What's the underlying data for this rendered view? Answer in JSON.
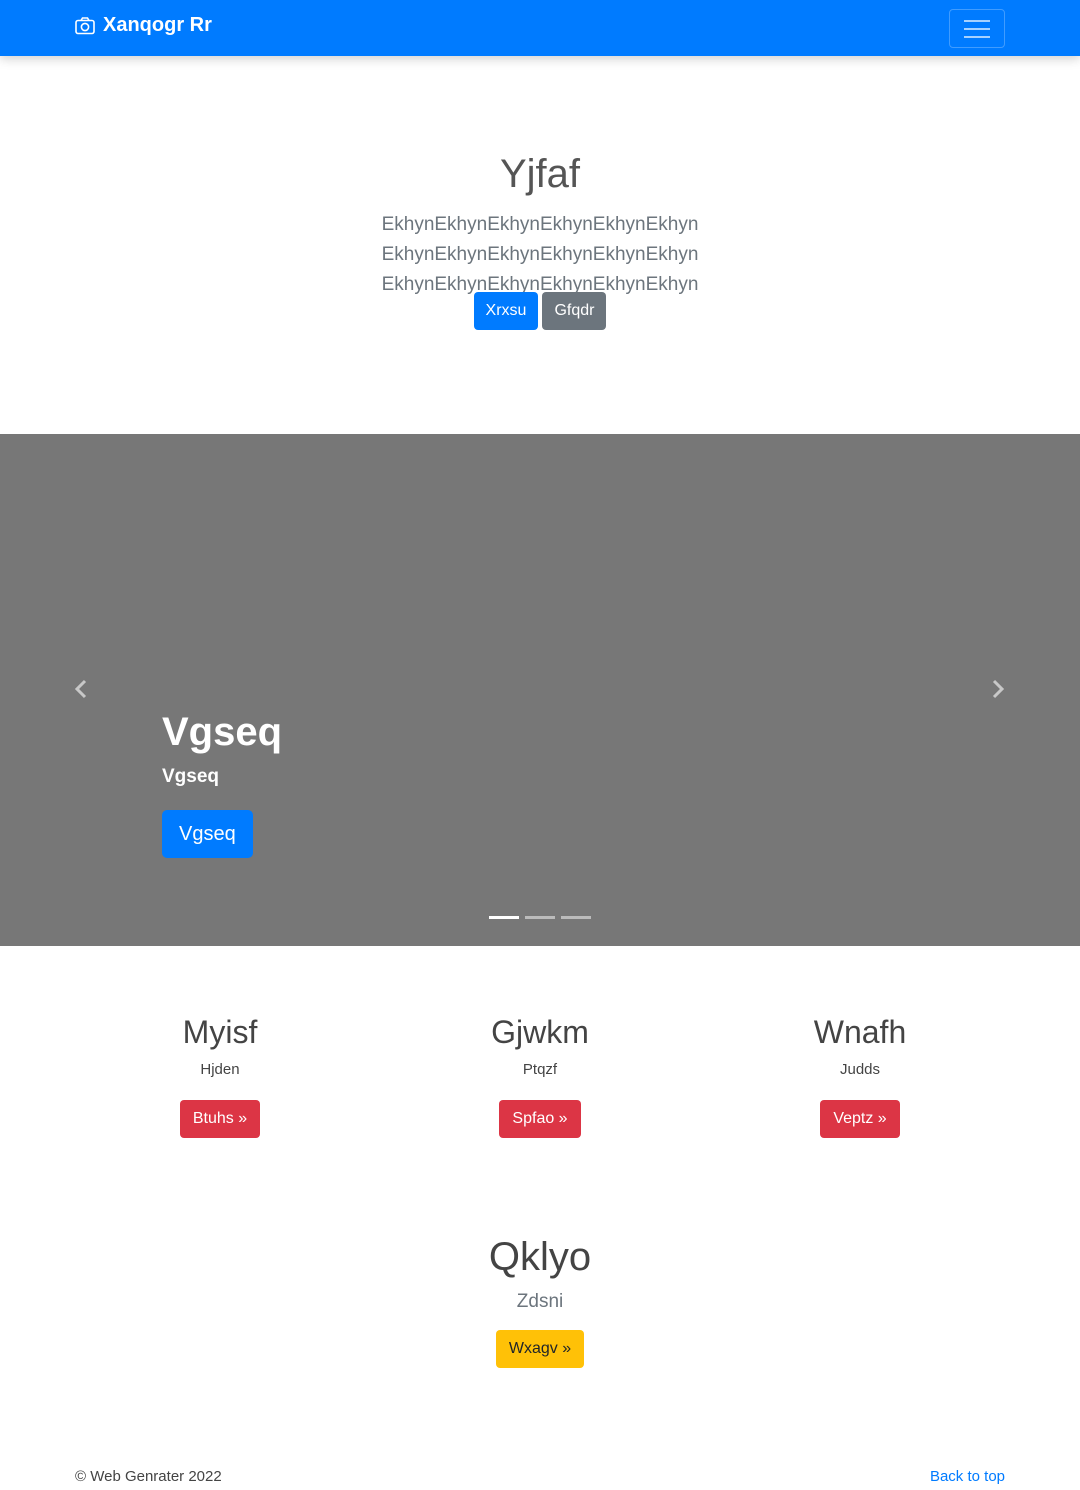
{
  "navbar": {
    "brand": "Xanqogr Rr",
    "brand_icon": "camera-icon",
    "toggler_icon": "hamburger-menu-icon",
    "bg_color": "#007bff"
  },
  "hero": {
    "title": "Yjfaf",
    "lead": "EkhynEkhynEkhynEkhynEkhynEkhyn EkhynEkhynEkhynEkhynEkhynEkhyn EkhynEkhynEkhynEkhynEkhynEkhyn",
    "primary_button": "Xrxsu",
    "secondary_button": "Gfqdr"
  },
  "carousel": {
    "bg_color": "#777777",
    "caption_title": "Vgseq",
    "caption_text": "Vgseq",
    "caption_button": "Vgseq",
    "prev_icon": "chevron-left-icon",
    "next_icon": "chevron-right-icon",
    "slide_count": 3,
    "active_slide": 1
  },
  "features": [
    {
      "title": "Myisf",
      "text": "Hjden",
      "button": "Btuhs »"
    },
    {
      "title": "Gjwkm",
      "text": "Ptqzf",
      "button": "Spfao »"
    },
    {
      "title": "Wnafh",
      "text": "Judds",
      "button": "Veptz »"
    }
  ],
  "big_feature": {
    "title": "Qklyo",
    "text": "Zdsni",
    "button": "Wxagv »"
  },
  "footer": {
    "copyright": "© Web Genrater 2022",
    "back_to_top": "Back to top"
  }
}
